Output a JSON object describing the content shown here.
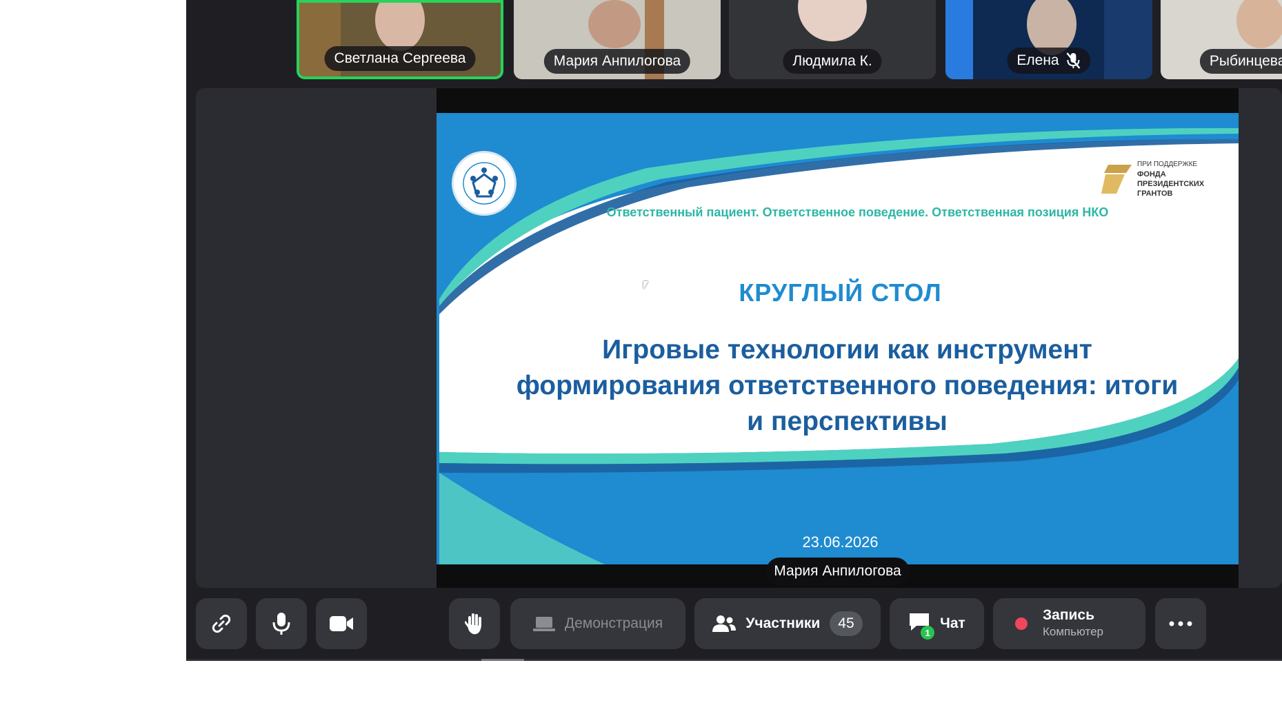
{
  "participants": [
    {
      "name": "Светлана Сергеева",
      "speaking": true,
      "muted": false
    },
    {
      "name": "Мария Анпилогова",
      "speaking": false,
      "muted": false
    },
    {
      "name": "Людмила К.",
      "speaking": false,
      "muted": false
    },
    {
      "name": "Елена",
      "speaking": false,
      "muted": true
    },
    {
      "name": "Рыбинцева ОЛ",
      "speaking": false,
      "muted": false
    }
  ],
  "slide": {
    "subtitle": "Ответственный пациент. Ответственное поведение. Ответственная позиция НКО",
    "sponsor_small": "ПРИ ПОДДЕРЖКЕ",
    "sponsor_line1": "ФОНДА",
    "sponsor_line2": "ПРЕЗИДЕНТСКИХ",
    "sponsor_line3": "ГРАНТОВ",
    "heading": "КРУГЛЫЙ СТОЛ",
    "title": "Игровые технологии как инструмент формирования ответственного поведения: итоги и перспективы",
    "date": "23.06.2026"
  },
  "presenter": "Мария Анпилогова",
  "toolbar": {
    "screen_share": "Демонстрация",
    "participants": "Участники",
    "participants_count": "45",
    "chat": "Чат",
    "chat_unread": "1",
    "record": "Запись",
    "record_sub": "Компьютер"
  },
  "colors": {
    "speaking_border": "#27d35a",
    "slide_blue": "#1f8bd0",
    "slide_teal": "#4fd1c0",
    "title_blue": "#1b5e9e"
  }
}
